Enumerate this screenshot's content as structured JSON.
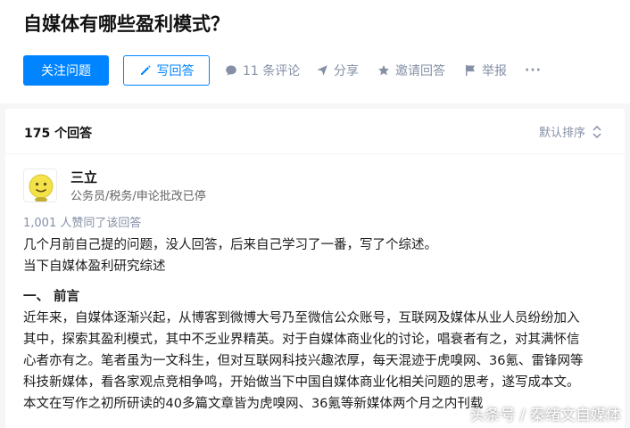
{
  "question": {
    "title": "自媒体有哪些盈利模式？"
  },
  "actions": {
    "follow_label": "关注问题",
    "write_label": "写回答",
    "comments_label": "11 条评论",
    "share_label": "分享",
    "invite_label": "邀请回答",
    "report_label": "举报",
    "more_label": "···"
  },
  "answers": {
    "count_label": "175 个回答",
    "sort_label": "默认排序"
  },
  "answer": {
    "author_name": "三立",
    "author_bio": "公务员/税务/申论批改已停",
    "votes_label": "1,001 人赞同了该回答",
    "paragraphs": [
      "几个月前自己提的问题，没人回答，后来自己学习了一番，写了个综述。",
      "当下自媒体盈利研究综述"
    ],
    "section_heading": "一、 前言",
    "section_lines": [
      "近年来，自媒体逐渐兴起，从博客到微博大号乃至微信公众账号，互联网及媒体从业人员纷纷加入",
      "其中，探索其盈利模式，其中不乏业界精英。对于自媒体商业化的讨论，唱衰者有之，对其满怀信",
      "心者亦有之。笔者虽为一文科生，但对互联网科技兴趣浓厚，每天混迹于虎嗅网、36氪、雷锋网等",
      "科技新媒体，看各家观点竞相争鸣，开始做当下中国自媒体商业化相关问题的思考，遂写成本文。",
      "本文在写作之初所研读的40多篇文章皆为虎嗅网、36氪等新媒体两个月之内刊载"
    ]
  },
  "watermark": "头条号 / 秦绪文自媒体",
  "colors": {
    "primary": "#0084ff",
    "muted": "#8590a6",
    "background": "#f6f6f6"
  }
}
